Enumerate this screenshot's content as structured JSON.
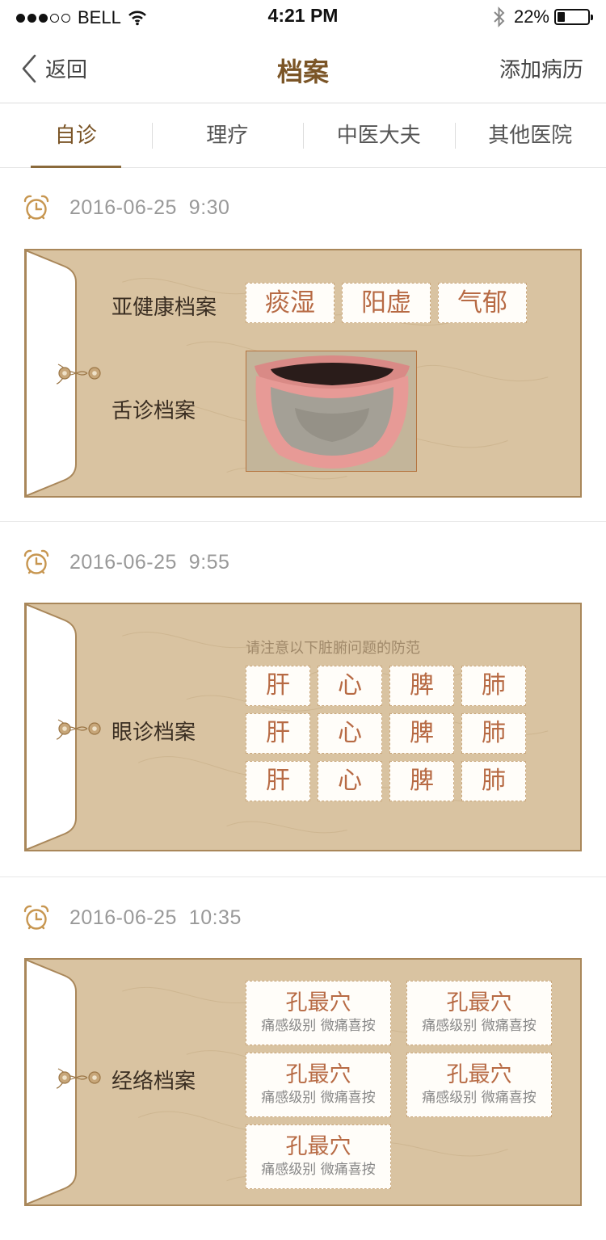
{
  "status_bar": {
    "carrier": "BELL",
    "time": "4:21 PM",
    "battery": "22%"
  },
  "nav": {
    "back_label": "返回",
    "title": "档案",
    "action_label": "添加病历"
  },
  "tabs": [
    {
      "label": "自诊",
      "active": true
    },
    {
      "label": "理疗",
      "active": false
    },
    {
      "label": "中医大夫",
      "active": false
    },
    {
      "label": "其他医院",
      "active": false
    }
  ],
  "records": [
    {
      "date": "2016-06-25",
      "time": "9:30",
      "subhealth_label": "亚健康档案",
      "subhealth_tags": [
        "痰湿",
        "阳虚",
        "气郁"
      ],
      "tongue_label": "舌诊档案"
    },
    {
      "date": "2016-06-25",
      "time": "9:55",
      "label": "眼诊档案",
      "hint": "请注意以下脏腑问题的防范",
      "organ_rows": [
        [
          "肝",
          "心",
          "脾",
          "肺"
        ],
        [
          "肝",
          "心",
          "脾",
          "肺"
        ],
        [
          "肝",
          "心",
          "脾",
          "肺"
        ]
      ]
    },
    {
      "date": "2016-06-25",
      "time": "10:35",
      "label": "经络档案",
      "points": [
        {
          "name": "孔最穴",
          "desc": "痛感级别 微痛喜按"
        },
        {
          "name": "孔最穴",
          "desc": "痛感级别 微痛喜按"
        },
        {
          "name": "孔最穴",
          "desc": "痛感级别 微痛喜按"
        },
        {
          "name": "孔最穴",
          "desc": "痛感级别 微痛喜按"
        },
        {
          "name": "孔最穴",
          "desc": "痛感级别 微痛喜按"
        }
      ]
    }
  ],
  "colors": {
    "accent": "#7b5527",
    "envelope": "#d9c3a1",
    "envelope_border": "#a9875a",
    "tag_text": "#b76a44"
  },
  "icons": {
    "back": "chevron-left-icon",
    "clock": "alarm-clock-icon",
    "knot": "string-knot-icon",
    "wifi": "wifi-icon",
    "bluetooth": "bluetooth-icon",
    "battery": "battery-icon"
  }
}
